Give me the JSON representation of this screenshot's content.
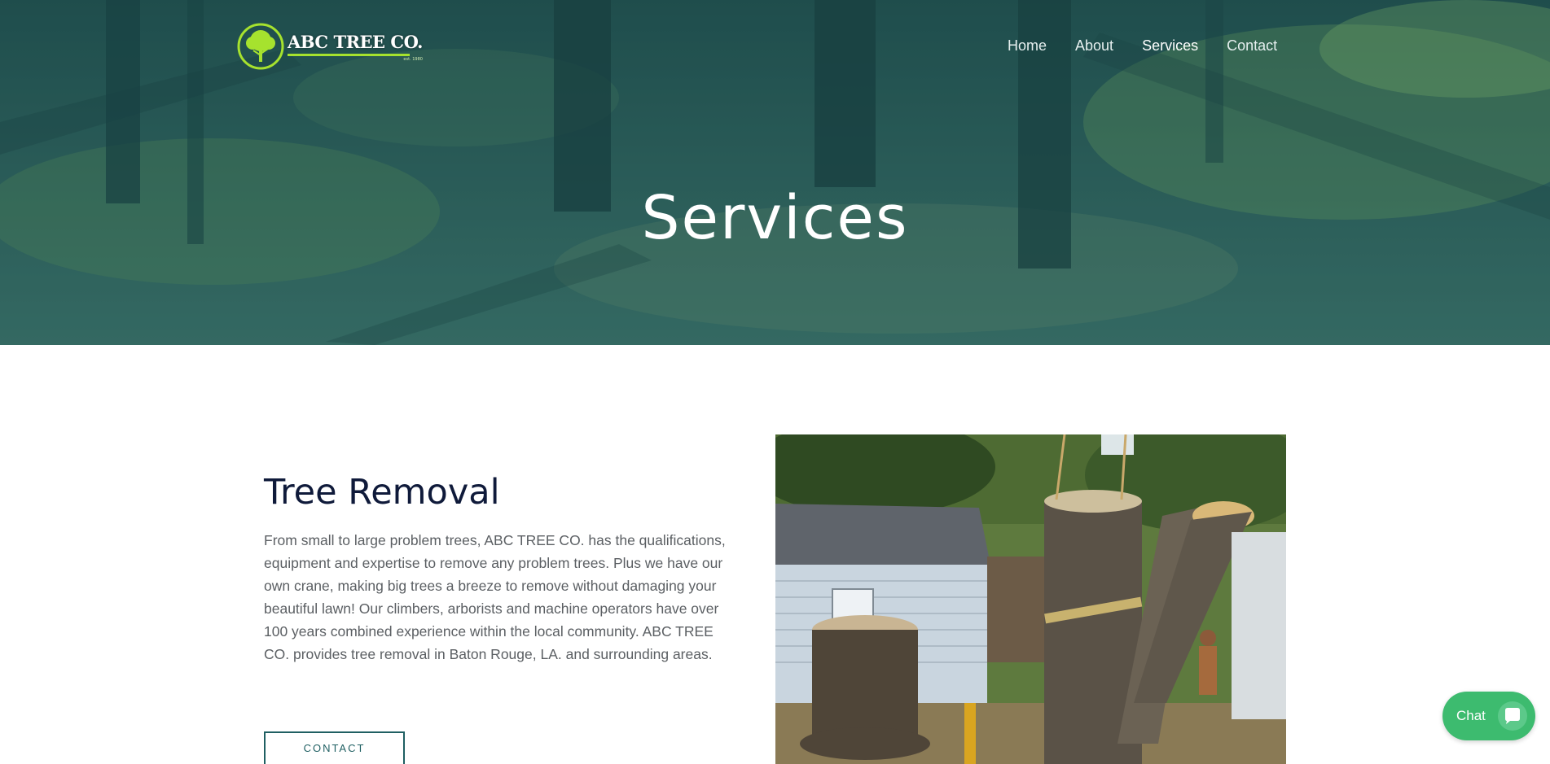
{
  "header": {
    "logo_text": "ABC TREE CO.",
    "logo_est": "est. 1980",
    "nav": [
      {
        "label": "Home"
      },
      {
        "label": "About"
      },
      {
        "label": "Services",
        "active": true
      },
      {
        "label": "Contact"
      }
    ]
  },
  "hero": {
    "title": "Services"
  },
  "main": {
    "section_title": "Tree Removal",
    "section_text": "From small to large problem trees, ABC TREE CO. has the qualifications, equipment and expertise to remove any problem trees. Plus we have our own crane, making big trees a breeze to remove without damaging your beautiful lawn! Our climbers, arborists and machine operators have over 100 years combined experience within the local community. ABC TREE CO. provides tree removal in Baton Rouge, LA. and surrounding areas.",
    "contact_label": "CONTACT"
  },
  "chat": {
    "label": "Chat"
  },
  "colors": {
    "accent_teal": "#1f5f62",
    "logo_green": "#a6e22e",
    "chat_green": "#3dbb6f",
    "heading_dark": "#0f1a3a"
  },
  "icons": {
    "logo": "tree-logo-icon",
    "chat": "chat-bubble-icon"
  }
}
